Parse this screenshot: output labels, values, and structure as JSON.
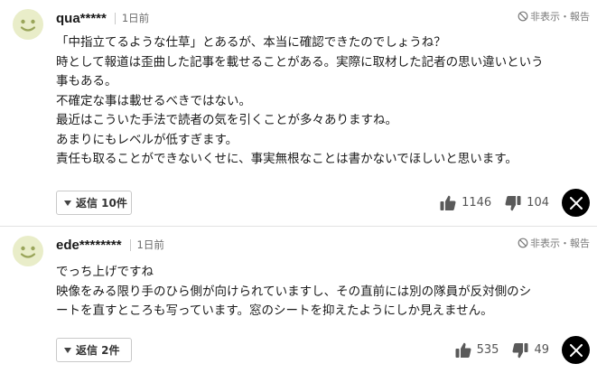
{
  "comments": [
    {
      "username": "qua*****",
      "time": "1日前",
      "report_label": "非表示・報告",
      "body_lines": [
        "「中指立てるような仕草」とあるが、本当に確認できたのでしょうね？",
        "時として報道は歪曲した記事を載せることがある。実際に取材した記者の思い違いという",
        "事もある。",
        "不確定な事は載せるべきではない。",
        "最近はこういた手法で読者の気を引くことが多々ありますね。",
        "あまりにもレベルが低すぎます。",
        "責任も取ることができないくせに、事実無根なことは書かないでほしいと思います。"
      ],
      "reply_label": "返信 10件",
      "likes": "1146",
      "dislikes": "104"
    },
    {
      "username": "ede********",
      "time": "1日前",
      "report_label": "非表示・報告",
      "body_lines": [
        "でっち上げですね",
        "映像をみる限り手のひら側が向けられていますし、その直前には別の隊員が反対側のシ",
        "ートを直すところも写っています。窓のシートを抑えたようにしか見えません。"
      ],
      "reply_label": "返信 2件",
      "likes": "535",
      "dislikes": "49"
    }
  ],
  "icons": {
    "avatar": "smiley-face-icon",
    "report": "block-icon",
    "reply_toggle": "triangle-down-icon",
    "like": "thumbs-up-icon",
    "dislike": "thumbs-down-icon",
    "share": "x-logo-icon"
  },
  "colors": {
    "avatar_bg": "#e9edc9",
    "avatar_face": "#9aa55a",
    "share_bg": "#000000",
    "divider": "#e3e3e3"
  }
}
